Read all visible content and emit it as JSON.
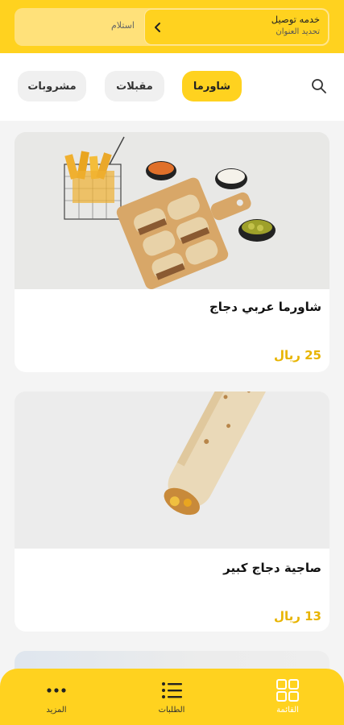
{
  "header": {
    "delivery_title": "خدمه توصيل",
    "delivery_subtitle": "تحديد العنوان",
    "pickup_label": "استلام"
  },
  "categories": [
    {
      "label": "شاورما",
      "active": true
    },
    {
      "label": "مقبلات",
      "active": false
    },
    {
      "label": "مشروبات",
      "active": false
    }
  ],
  "products": [
    {
      "name": "شاورما عربي دجاج",
      "price": "25 ريال"
    },
    {
      "name": "صاجية دجاج كبير",
      "price": "13 ريال"
    }
  ],
  "bottom_nav": [
    {
      "label": "القائمة",
      "icon": "grid-icon",
      "active": true
    },
    {
      "label": "الطلبات",
      "icon": "list-icon",
      "active": false
    },
    {
      "label": "المزيد",
      "icon": "more-dots-icon",
      "active": false
    }
  ],
  "colors": {
    "accent": "#ffd21f",
    "price": "#e8b400"
  }
}
